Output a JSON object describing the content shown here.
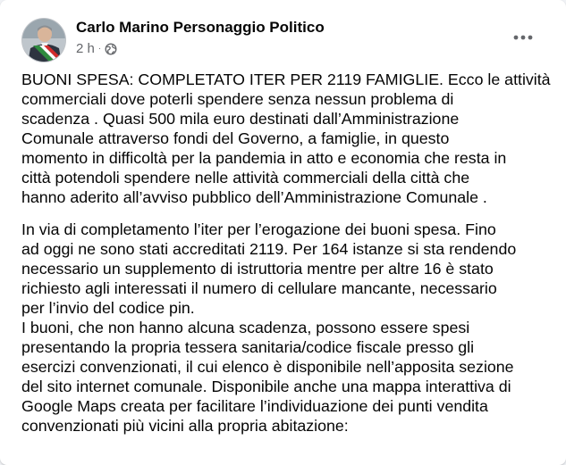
{
  "post": {
    "author": "Carlo Marino Personaggio Politico",
    "time": "2 h",
    "separator": "·",
    "privacy_icon": "globe-icon",
    "more_icon": "more-options-icon",
    "paragraphs": [
      "BUONI SPESA: COMPLETATO ITER PER 2119 FAMIGLIE. Ecco le attività\ncommerciali dove poterli spendere senza nessun problema di\nscadenza . Quasi 500 mila euro destinati dall’Amministrazione\nComunale attraverso fondi del Governo, a famiglie,  in questo\nmomento in difficoltà per la pandemia in atto e economia che resta in\ncittà potendoli spendere nelle attività commerciali della città che\nhanno aderito all’avviso pubblico dell’Amministrazione Comunale .",
      "In via di completamento l’iter per l’erogazione dei buoni spesa. Fino\nad oggi ne sono stati accreditati 2119. Per 164 istanze si sta rendendo\nnecessario un supplemento di istruttoria mentre per altre 16 è stato\nrichiesto agli interessati il numero di cellulare mancante, necessario\nper l’invio del codice pin.\nI buoni, che non hanno alcuna scadenza, possono essere spesi\npresentando la propria tessera sanitaria/codice fiscale presso gli\nesercizi convenzionati, il cui elenco è disponibile nell’apposita sezione\ndel sito internet comunale. Disponibile anche una mappa interattiva di\nGoogle Maps creata per facilitare l’individuazione dei punti vendita\nconvenzionati più vicini alla propria abitazione:"
    ]
  },
  "colors": {
    "background": "#f0f2f5",
    "card": "#ffffff",
    "text_primary": "#050505",
    "text_secondary": "#65676b",
    "sash_green": "#2e8b3e",
    "sash_white": "#ffffff",
    "sash_red": "#d32b2b"
  }
}
